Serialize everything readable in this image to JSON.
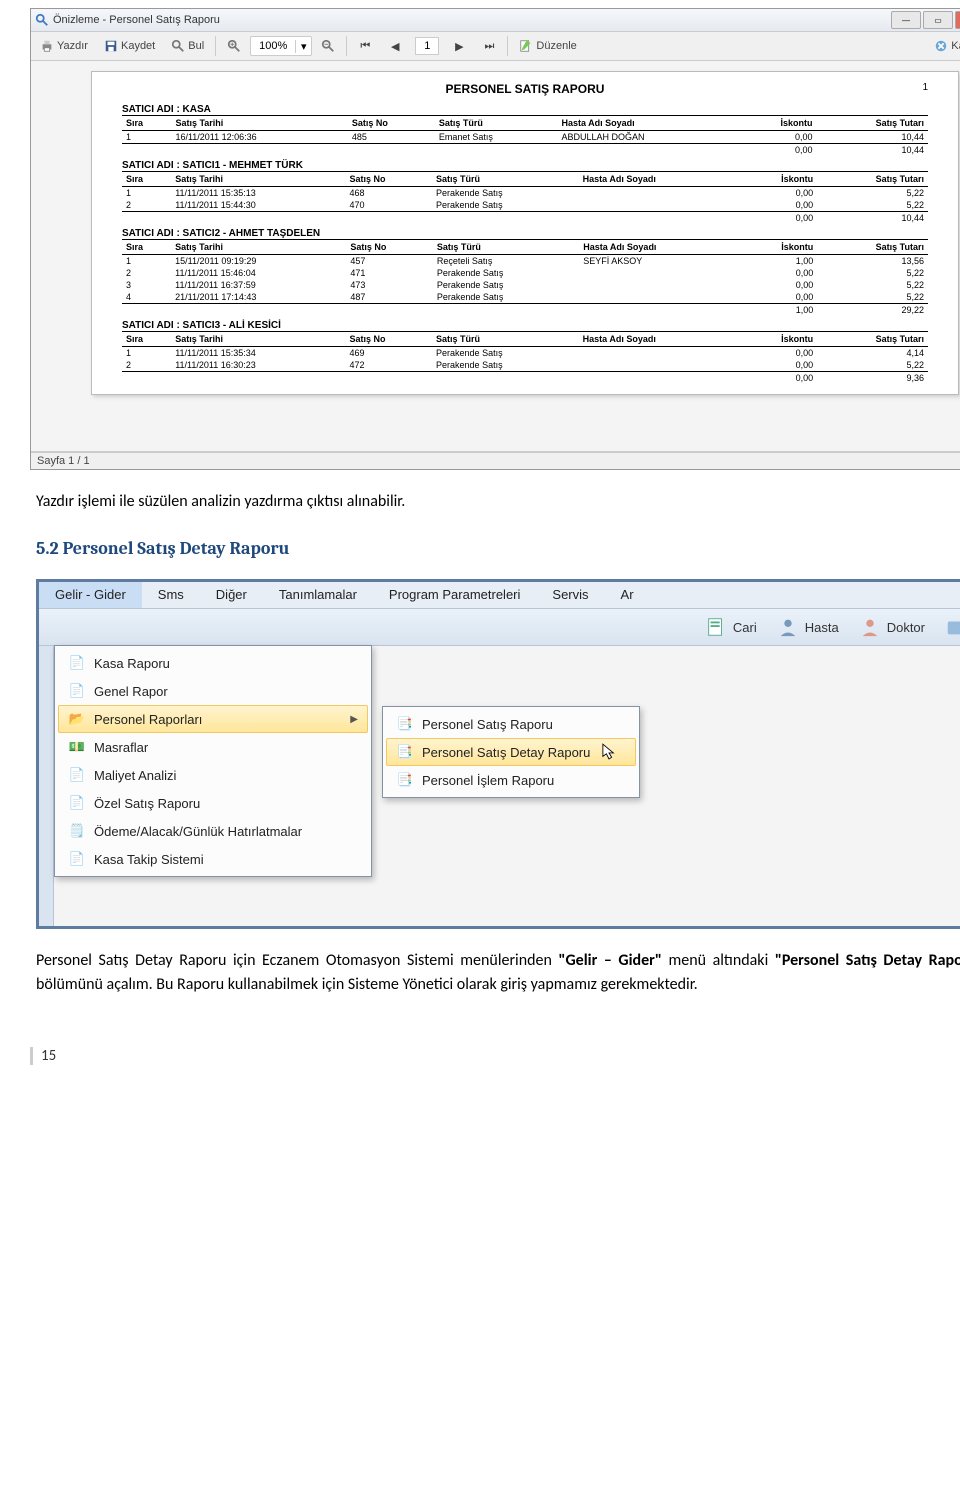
{
  "window": {
    "title": "Önizleme - Personel Satış Raporu"
  },
  "toolbar": {
    "print": "Yazdır",
    "save": "Kaydet",
    "find": "Bul",
    "zoom": "100%",
    "page_current": "1",
    "edit": "Düzenle",
    "close": "Kapat"
  },
  "statusbar": {
    "text": "Sayfa 1 / 1"
  },
  "report": {
    "title": "PERSONEL SATIŞ RAPORU",
    "page_no": "1",
    "columns": {
      "sira": "Sıra",
      "tarih": "Satış Tarihi",
      "no": "Satış No",
      "tur": "Satış Türü",
      "hasta": "Hasta Adı Soyadı",
      "iskonto": "İskontu",
      "tutar": "Satış Tutarı"
    },
    "s1": {
      "head": "SATICI ADI :  KASA",
      "r1_tarih": "16/11/2011 12:06:36",
      "r1_no": "485",
      "r1_tur": "Emanet Satış",
      "r1_hasta": "ABDULLAH DOĞAN",
      "r1_isk": "0,00",
      "r1_tut": "10,44",
      "sum_isk": "0,00",
      "sum_tut": "10,44"
    },
    "s2": {
      "head": "SATICI ADI :  SATICI1 - MEHMET TÜRK",
      "r1_tarih": "11/11/2011 15:35:13",
      "r1_no": "468",
      "r1_tur": "Perakende Satış",
      "r1_isk": "0,00",
      "r1_tut": "5,22",
      "r2_tarih": "11/11/2011 15:44:30",
      "r2_no": "470",
      "r2_tur": "Perakende Satış",
      "r2_isk": "0,00",
      "r2_tut": "5,22",
      "sum_isk": "0,00",
      "sum_tut": "10,44"
    },
    "s3": {
      "head": "SATICI ADI :  SATICI2 - AHMET TAŞDELEN",
      "r1_tarih": "15/11/2011 09:19:29",
      "r1_no": "457",
      "r1_tur": "Reçeteli Satış",
      "r1_hasta": "SEYFİ AKSOY",
      "r1_isk": "1,00",
      "r1_tut": "13,56",
      "r2_tarih": "11/11/2011 15:46:04",
      "r2_no": "471",
      "r2_tur": "Perakende Satış",
      "r2_isk": "0,00",
      "r2_tut": "5,22",
      "r3_tarih": "11/11/2011 16:37:59",
      "r3_no": "473",
      "r3_tur": "Perakende Satış",
      "r3_isk": "0,00",
      "r3_tut": "5,22",
      "r4_tarih": "21/11/2011 17:14:43",
      "r4_no": "487",
      "r4_tur": "Perakende Satış",
      "r4_isk": "0,00",
      "r4_tut": "5,22",
      "sum_isk": "1,00",
      "sum_tut": "29,22"
    },
    "s4": {
      "head": "SATICI ADI :  SATICI3 - ALİ KESİCİ",
      "r1_tarih": "11/11/2011 15:35:34",
      "r1_no": "469",
      "r1_tur": "Perakende Satış",
      "r1_isk": "0,00",
      "r1_tut": "4,14",
      "r2_tarih": "11/11/2011 16:30:23",
      "r2_no": "472",
      "r2_tur": "Perakende Satış",
      "r2_isk": "0,00",
      "r2_tut": "5,22",
      "sum_isk": "0,00",
      "sum_tut": "9,36"
    }
  },
  "doc": {
    "p1": "Yazdır işlemi ile süzülen analizin yazdırma çıktısı alınabilir.",
    "h2": "5.2 Personel Satış Detay Raporu",
    "p2a": "Personel Satış Detay Raporu için Eczanem Otomasyon Sistemi menülerinden ",
    "p2b": "\"Gelir – Gider\"",
    "p2c": " menü altındaki ",
    "p2d": "\"Personel Satış Detay Raporu\"",
    "p2e": " bölümünü açalım. Bu Raporu kullanabilmek için Sisteme Yönetici olarak giriş yapmamız gerekmektedir.",
    "page_num": "15"
  },
  "menubar": {
    "m1": "Gelir  -  Gider",
    "m2": "Sms",
    "m3": "Diğer",
    "m4": "Tanımlamalar",
    "m5": "Program Parametreleri",
    "m6": "Servis",
    "m7": "Ar"
  },
  "ribbon": {
    "cari": "Cari",
    "hasta": "Hasta",
    "doktor": "Doktor"
  },
  "dd": {
    "kasa": "Kasa Raporu",
    "genel": "Genel Rapor",
    "personel": "Personel Raporları",
    "masraf": "Masraflar",
    "maliyet": "Maliyet Analizi",
    "ozel": "Özel Satış Raporu",
    "odeme": "Ödeme/Alacak/Günlük Hatırlatmalar",
    "kasa_takip": "Kasa Takip Sistemi"
  },
  "sub": {
    "s1": "Personel Satış Raporu",
    "s2": "Personel Satış Detay Raporu",
    "s3": "Personel İşlem Raporu"
  }
}
